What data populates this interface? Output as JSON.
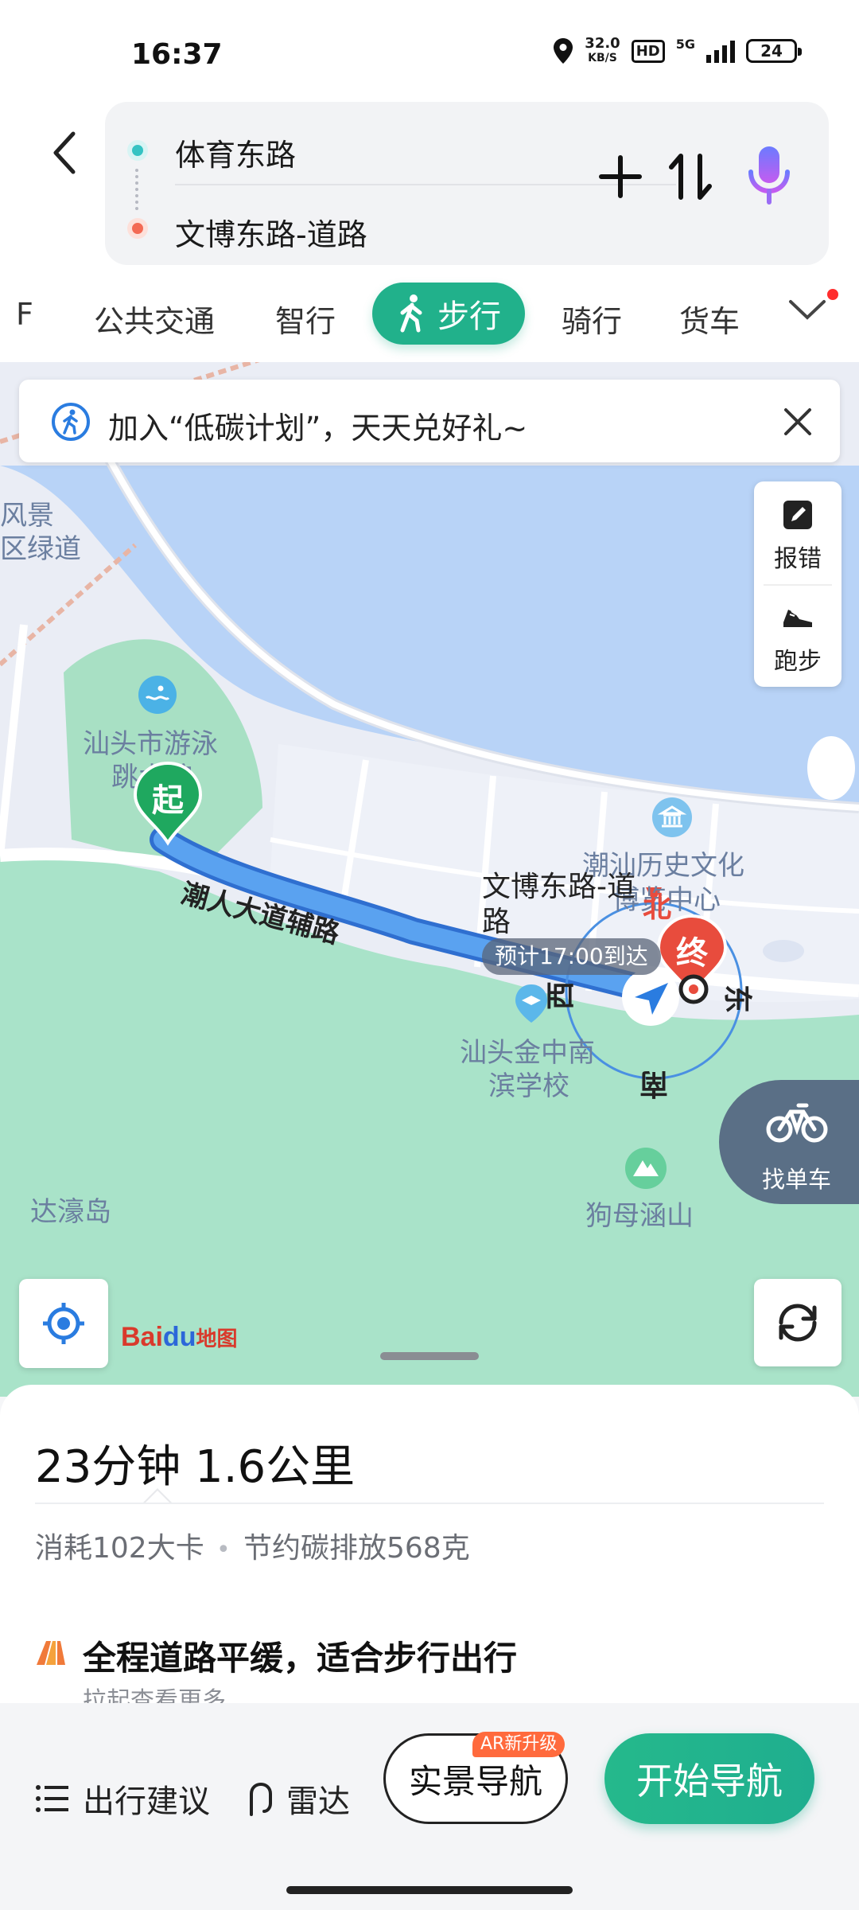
{
  "status": {
    "time": "16:37",
    "net_speed_value": "32.0",
    "net_speed_unit": "KB/S",
    "hd": "HD",
    "signal": "5G",
    "battery": "24"
  },
  "route": {
    "from": "体育东路",
    "to": "文博东路-道路"
  },
  "tabs": {
    "partial": "F",
    "transit": "公共交通",
    "smart": "智行",
    "walk": "步行",
    "ride": "骑行",
    "truck": "货车"
  },
  "banner": {
    "text": "加入“低碳计划”，天天兑好礼~"
  },
  "tools": {
    "report": "报错",
    "run": "跑步"
  },
  "map": {
    "labels": {
      "scenic_1": "风景",
      "scenic_2": "区绿道",
      "swim_1": "汕头市游泳",
      "swim_2": "跳水馆",
      "museum_1": "潮汕历史文化",
      "museum_2": "博览中心",
      "road": "潮人大道辅路",
      "dest_1": "文博东路-道",
      "dest_2": "路",
      "school_1": "汕头金中南",
      "school_2": "滨学校",
      "island": "达濠岛",
      "mountain": "狗母涵山"
    },
    "start_marker": "起",
    "end_marker": "终",
    "compass": {
      "north": "北",
      "east": "东",
      "south": "南",
      "west": "西"
    },
    "eta": "预计17:00到达",
    "bike": "找单车",
    "logo_bai": "Bai",
    "logo_du": "du",
    "logo_map": "地图"
  },
  "summary": {
    "time_distance": "23分钟  1.6公里",
    "calories": "消耗102大卡",
    "separator": "•",
    "carbon": "节约碳排放568克",
    "tip_title": "全程道路平缓，适合步行出行",
    "tip_sub": "拉起查看更多"
  },
  "bottom": {
    "advice": "出行建议",
    "radar": "雷达",
    "ar_nav": "实景导航",
    "ar_badge": "AR新升级",
    "start": "开始导航"
  },
  "colors": {
    "accent": "#21b18b",
    "route": "#4a90e2",
    "end_marker": "#e84c3d",
    "start_marker": "#1fa85f"
  }
}
